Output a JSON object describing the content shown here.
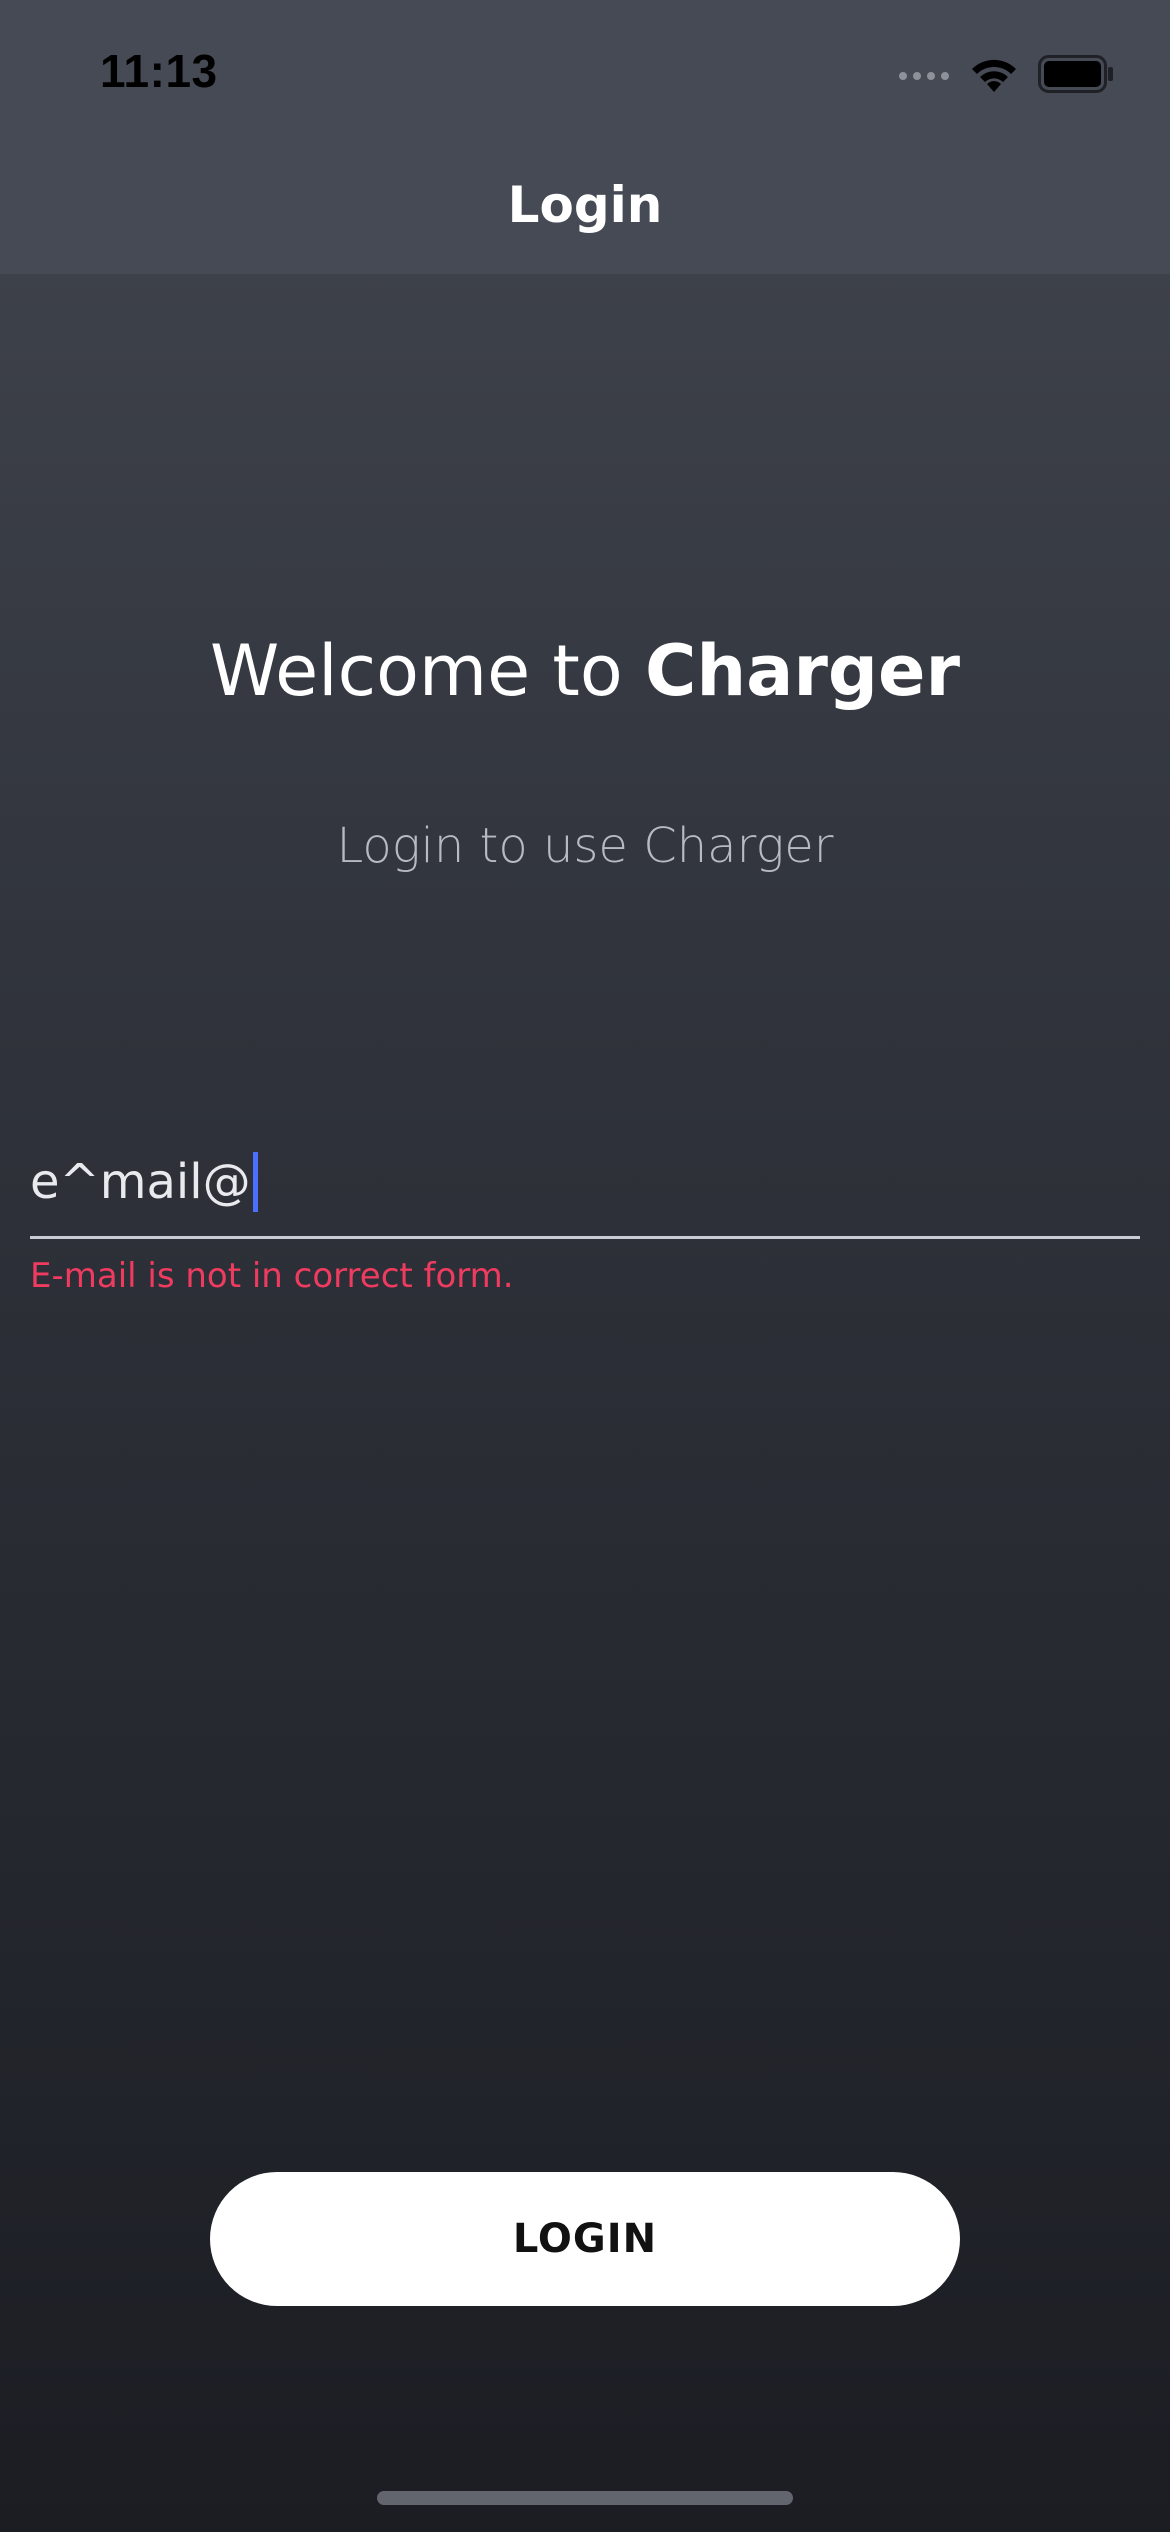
{
  "status_bar": {
    "time": "11:13",
    "icons": [
      "cellular-signal-icon",
      "wifi-icon",
      "battery-icon"
    ]
  },
  "nav": {
    "title": "Login"
  },
  "welcome": {
    "prefix": "Welcome to ",
    "brand": "Charger"
  },
  "subtitle": "Login to use Charger",
  "email_field": {
    "value": "e^mail@",
    "error": "E-mail is not in correct form."
  },
  "login_button": {
    "label": "LOGIN"
  },
  "colors": {
    "error": "#ef3b5f",
    "caret": "#4b6fff",
    "button_bg": "#ffffff",
    "nav_bg": "#464a54"
  }
}
